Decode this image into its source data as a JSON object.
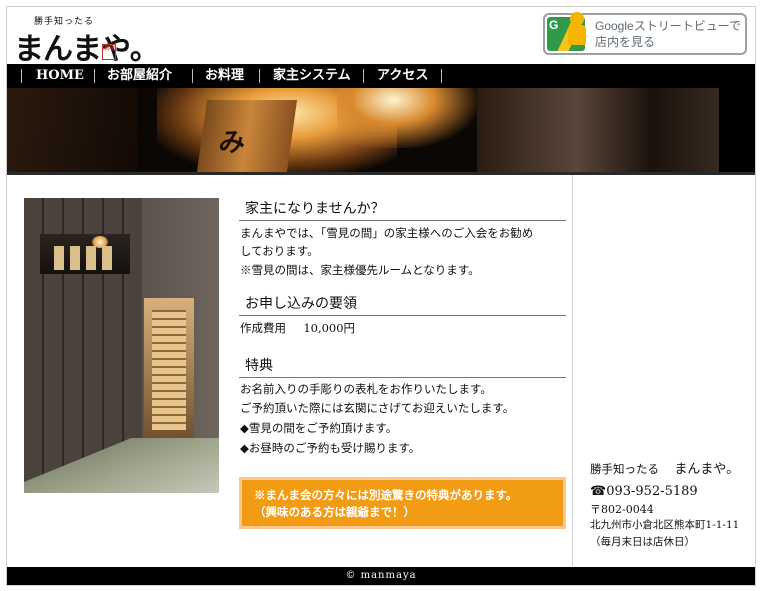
{
  "header": {
    "logo_small": "勝手知ったる",
    "logo_big": "まんまや。",
    "logo_seal": "酒場",
    "streetview_line1": "Googleストリートビューで",
    "streetview_line2": "店内を見る",
    "streetview_map_letter": "G"
  },
  "nav": {
    "items": [
      "HOME",
      "お部屋紹介",
      "お料理",
      "家主システム",
      "アクセス"
    ]
  },
  "banner": {
    "sign_text": "み"
  },
  "main": {
    "section1_title": "家主になりませんか？",
    "section1_line1": "まんまやでは、「雪見の間」の家主様へのご入会をお勧め",
    "section1_line2": "しております。",
    "section1_note": "※雪見の間は、家主様優先ルームとなります。",
    "section2_title": "お申し込みの要領",
    "section2_fee_label": "作成費用",
    "section2_fee_value": "10,000円",
    "section3_title": "特典",
    "section3_line1": "お名前入りの手彫りの表札をお作りいたします。",
    "section3_line2": "ご予約頂いた際には玄関にさげてお迎えいたします。",
    "section3_bullet1": "◆雪見の間をご予約頂けます。",
    "section3_bullet2": "◆お昼時のご予約も受け賜ります。",
    "notice_line1": "※まんま会の方々には別途驚きの特典があります。",
    "notice_line2": "（興味のある方は親爺まで！）"
  },
  "sidebar": {
    "shop_prefix": "勝手知ったる",
    "shop_name": "まんまや。",
    "phone": "☎093-952-5189",
    "postal": "〒802-0044",
    "address": "北九州市小倉北区熊本町1-1-11",
    "holiday": "（毎月末日は店休日）"
  },
  "footer": {
    "copyright": "© manmaya"
  },
  "colors": {
    "notice_bg": "#f29b14",
    "nav_bg": "#000000",
    "streetview_green": "#2e9a4a",
    "streetview_yellow": "#f5b400"
  }
}
